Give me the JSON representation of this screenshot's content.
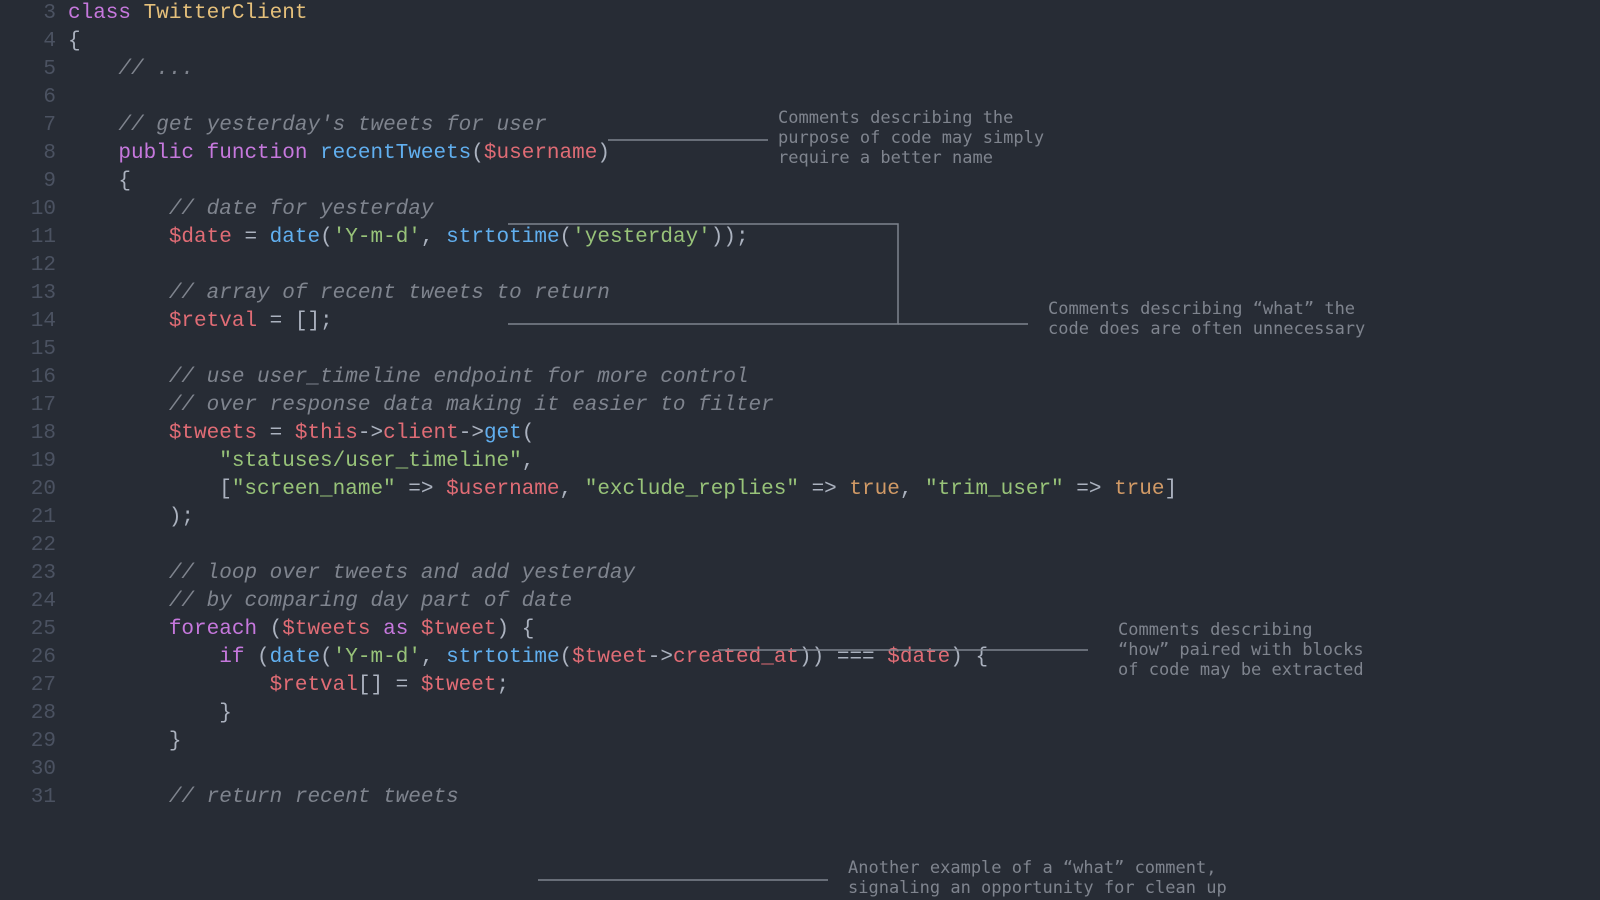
{
  "gutter_start": 3,
  "gutter_end": 31,
  "code_lines": [
    [
      {
        "t": "kw",
        "v": "class "
      },
      {
        "t": "cls",
        "v": "TwitterClient"
      }
    ],
    [
      {
        "t": "punc",
        "v": "{"
      }
    ],
    [
      {
        "t": "punc",
        "v": "    "
      },
      {
        "t": "cmt",
        "v": "// ..."
      }
    ],
    [],
    [
      {
        "t": "punc",
        "v": "    "
      },
      {
        "t": "cmt",
        "v": "// get yesterday's tweets for user"
      }
    ],
    [
      {
        "t": "punc",
        "v": "    "
      },
      {
        "t": "kw",
        "v": "public function "
      },
      {
        "t": "fn",
        "v": "recentTweets"
      },
      {
        "t": "punc",
        "v": "("
      },
      {
        "t": "var",
        "v": "$username"
      },
      {
        "t": "punc",
        "v": ")"
      }
    ],
    [
      {
        "t": "punc",
        "v": "    {"
      }
    ],
    [
      {
        "t": "punc",
        "v": "        "
      },
      {
        "t": "cmt",
        "v": "// date for yesterday"
      }
    ],
    [
      {
        "t": "punc",
        "v": "        "
      },
      {
        "t": "var",
        "v": "$date"
      },
      {
        "t": "op",
        "v": " = "
      },
      {
        "t": "fn",
        "v": "date"
      },
      {
        "t": "punc",
        "v": "("
      },
      {
        "t": "str",
        "v": "'Y-m-d'"
      },
      {
        "t": "punc",
        "v": ", "
      },
      {
        "t": "fn",
        "v": "strtotime"
      },
      {
        "t": "punc",
        "v": "("
      },
      {
        "t": "str",
        "v": "'yesterday'"
      },
      {
        "t": "punc",
        "v": "));"
      }
    ],
    [],
    [
      {
        "t": "punc",
        "v": "        "
      },
      {
        "t": "cmt",
        "v": "// array of recent tweets to return"
      }
    ],
    [
      {
        "t": "punc",
        "v": "        "
      },
      {
        "t": "var",
        "v": "$retval"
      },
      {
        "t": "op",
        "v": " = [];"
      }
    ],
    [],
    [
      {
        "t": "punc",
        "v": "        "
      },
      {
        "t": "cmt",
        "v": "// use user_timeline endpoint for more control"
      }
    ],
    [
      {
        "t": "punc",
        "v": "        "
      },
      {
        "t": "cmt",
        "v": "// over response data making it easier to filter"
      }
    ],
    [
      {
        "t": "punc",
        "v": "        "
      },
      {
        "t": "var",
        "v": "$tweets"
      },
      {
        "t": "op",
        "v": " = "
      },
      {
        "t": "var",
        "v": "$this"
      },
      {
        "t": "op",
        "v": "->"
      },
      {
        "t": "prop",
        "v": "client"
      },
      {
        "t": "op",
        "v": "->"
      },
      {
        "t": "fn",
        "v": "get"
      },
      {
        "t": "punc",
        "v": "("
      }
    ],
    [
      {
        "t": "punc",
        "v": "            "
      },
      {
        "t": "str",
        "v": "\"statuses/user_timeline\""
      },
      {
        "t": "punc",
        "v": ","
      }
    ],
    [
      {
        "t": "punc",
        "v": "            ["
      },
      {
        "t": "str",
        "v": "\"screen_name\""
      },
      {
        "t": "op",
        "v": " => "
      },
      {
        "t": "var",
        "v": "$username"
      },
      {
        "t": "punc",
        "v": ", "
      },
      {
        "t": "str",
        "v": "\"exclude_replies\""
      },
      {
        "t": "op",
        "v": " => "
      },
      {
        "t": "const",
        "v": "true"
      },
      {
        "t": "punc",
        "v": ", "
      },
      {
        "t": "str",
        "v": "\"trim_user\""
      },
      {
        "t": "op",
        "v": " => "
      },
      {
        "t": "const",
        "v": "true"
      },
      {
        "t": "punc",
        "v": "]"
      }
    ],
    [
      {
        "t": "punc",
        "v": "        );"
      }
    ],
    [],
    [
      {
        "t": "punc",
        "v": "        "
      },
      {
        "t": "cmt",
        "v": "// loop over tweets and add yesterday"
      }
    ],
    [
      {
        "t": "punc",
        "v": "        "
      },
      {
        "t": "cmt",
        "v": "// by comparing day part of date"
      }
    ],
    [
      {
        "t": "punc",
        "v": "        "
      },
      {
        "t": "kw",
        "v": "foreach"
      },
      {
        "t": "punc",
        "v": " ("
      },
      {
        "t": "var",
        "v": "$tweets"
      },
      {
        "t": "kw",
        "v": " as "
      },
      {
        "t": "var",
        "v": "$tweet"
      },
      {
        "t": "punc",
        "v": ") {"
      }
    ],
    [
      {
        "t": "punc",
        "v": "            "
      },
      {
        "t": "kw",
        "v": "if"
      },
      {
        "t": "punc",
        "v": " ("
      },
      {
        "t": "fn",
        "v": "date"
      },
      {
        "t": "punc",
        "v": "("
      },
      {
        "t": "str",
        "v": "'Y-m-d'"
      },
      {
        "t": "punc",
        "v": ", "
      },
      {
        "t": "fn",
        "v": "strtotime"
      },
      {
        "t": "punc",
        "v": "("
      },
      {
        "t": "var",
        "v": "$tweet"
      },
      {
        "t": "op",
        "v": "->"
      },
      {
        "t": "prop",
        "v": "created_at"
      },
      {
        "t": "punc",
        "v": ")) === "
      },
      {
        "t": "var",
        "v": "$date"
      },
      {
        "t": "punc",
        "v": ") {"
      }
    ],
    [
      {
        "t": "punc",
        "v": "                "
      },
      {
        "t": "var",
        "v": "$retval"
      },
      {
        "t": "punc",
        "v": "[] = "
      },
      {
        "t": "var",
        "v": "$tweet"
      },
      {
        "t": "punc",
        "v": ";"
      }
    ],
    [
      {
        "t": "punc",
        "v": "            }"
      }
    ],
    [
      {
        "t": "punc",
        "v": "        }"
      }
    ],
    [],
    [
      {
        "t": "punc",
        "v": "        "
      },
      {
        "t": "cmt",
        "v": "// return recent tweets"
      }
    ]
  ],
  "annotations": {
    "a1": "Comments describing the\npurpose of code may simply\nrequire a better name",
    "a2": "Comments describing “what” the\ncode does are often unnecessary",
    "a3": "Comments describing\n“how” paired with blocks\nof code may be extracted",
    "a4": "Another example of a “what” comment,\nsignaling an opportunity for clean up"
  }
}
